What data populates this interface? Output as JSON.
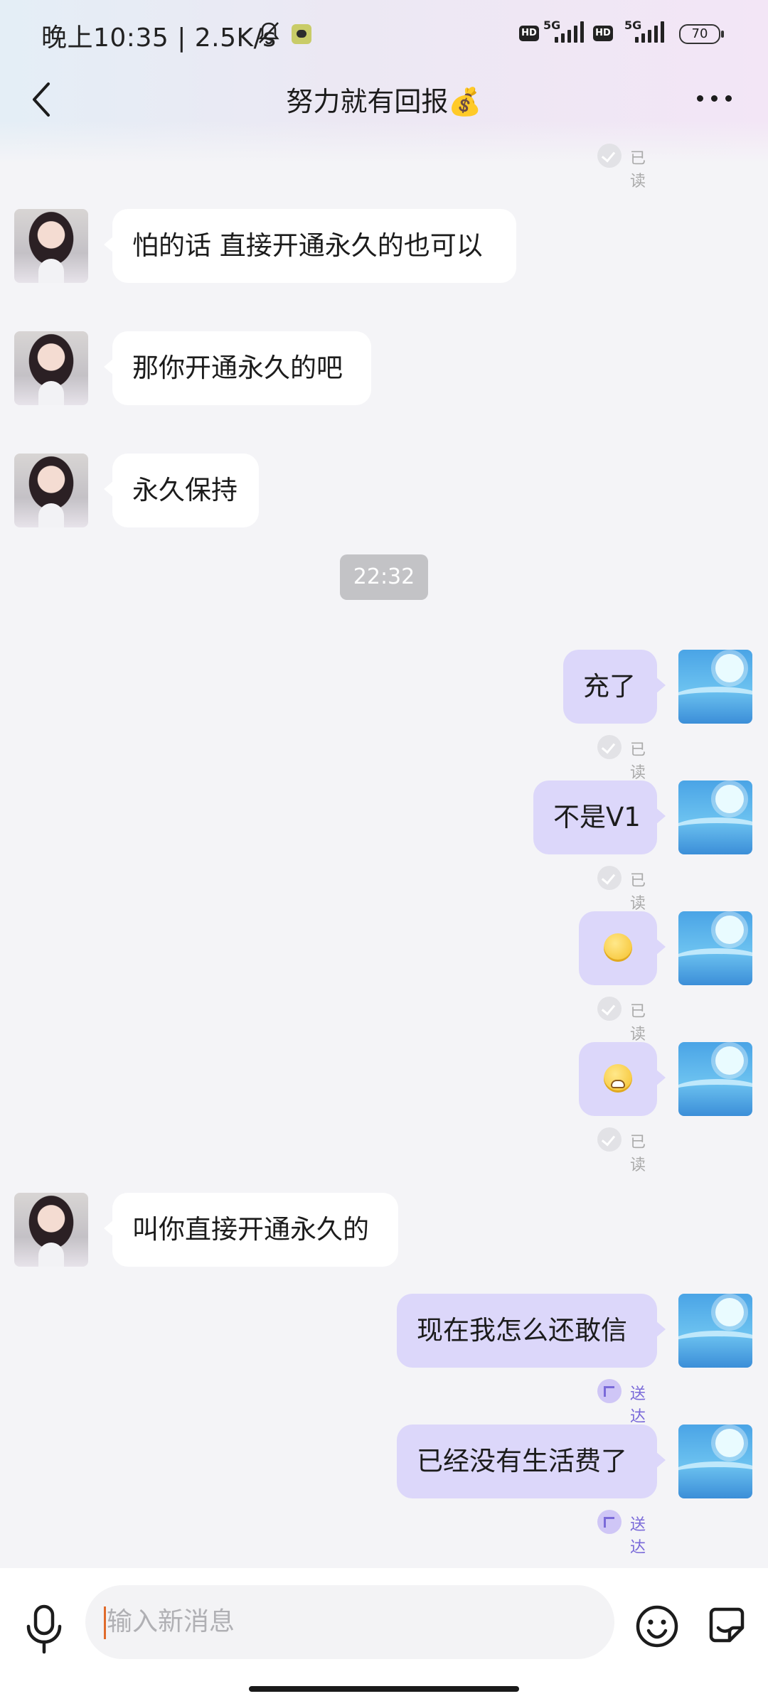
{
  "status_bar": {
    "time": "晚上10:35 | 2.5K/s",
    "network_1": "5G",
    "network_2": "5G",
    "hd_1": "HD",
    "hd_2": "HD",
    "battery": "70"
  },
  "header": {
    "title": "努力就有回报💰"
  },
  "messages": [
    {
      "side": "right",
      "status": "已读"
    },
    {
      "side": "left",
      "text": "怕的话 直接开通永久的也可以"
    },
    {
      "side": "left",
      "text": "那你开通永久的吧"
    },
    {
      "side": "left",
      "text": "永久保持"
    },
    {
      "side": "left",
      "text": "叫你直接开通永久的"
    },
    {
      "side": "right",
      "text": "充了",
      "status": "已读"
    },
    {
      "side": "right",
      "text": "不是V1",
      "status": "已读"
    },
    {
      "side": "right",
      "emoji": "smirk-emoji",
      "status": "已读"
    },
    {
      "side": "right",
      "emoji": "crying-emoji",
      "status": "已读"
    },
    {
      "side": "right",
      "text": "现在我怎么还敢信",
      "status": "送达"
    },
    {
      "side": "right",
      "text": "已经没有生活费了",
      "status": "送达"
    }
  ],
  "time_divider": "22:32",
  "composer": {
    "placeholder": "输入新消息"
  },
  "colors": {
    "right_bubble": "#dcd7fa",
    "left_bubble": "#ffffff",
    "delivered_accent": "#7a6ad9"
  }
}
